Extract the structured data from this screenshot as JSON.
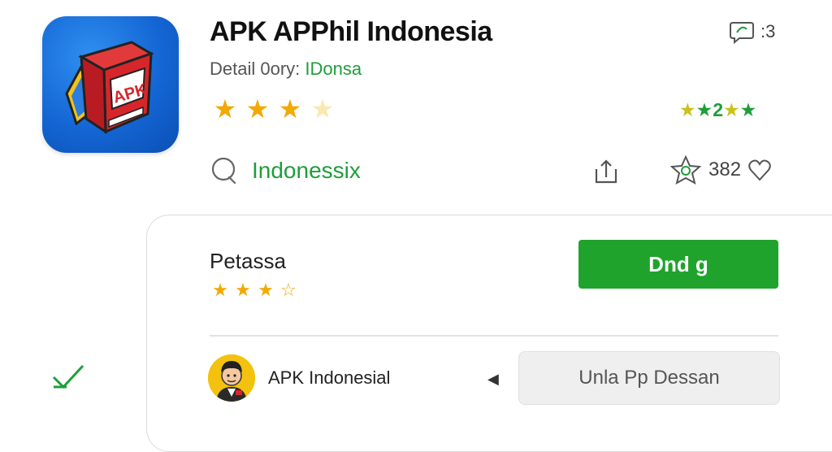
{
  "app": {
    "title": "APK APPhil Indonesia",
    "subtitle_prefix": "Detail 0ory: ",
    "subtitle_accent": "IDonsa",
    "icon_text": "APK"
  },
  "top_rating": {
    "stars_filled": 3,
    "stars_total": 4
  },
  "green_rating": {
    "text": "2"
  },
  "badge": {
    "text": ":3"
  },
  "search": {
    "text": "Indonessix"
  },
  "favorites": {
    "count": "382"
  },
  "card": {
    "title": "Petassa",
    "rating": {
      "stars_filled": 3,
      "stars_total": 4
    },
    "download_label": "Dnd g"
  },
  "developer": {
    "name": "APK Indonesial",
    "button_label": "Unla Pp Dessan"
  },
  "colors": {
    "accent_green": "#1fa32c",
    "star_gold": "#f2a900",
    "icon_blue": "#1466d4",
    "apk_red": "#d7262b"
  },
  "icons": [
    "app-icon",
    "star-icon",
    "green-star-icon",
    "badge-icon",
    "search-icon",
    "share-icon",
    "favorite-star-icon",
    "heart-icon",
    "back-arrow-icon",
    "check-icon",
    "developer-avatar"
  ]
}
